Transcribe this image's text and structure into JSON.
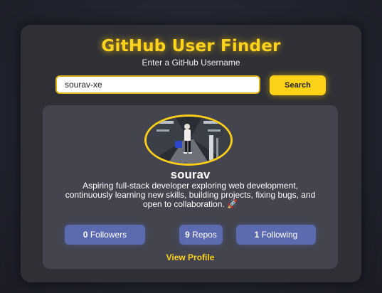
{
  "header": {
    "title": "GitHub User Finder",
    "subtitle": "Enter a GitHub Username"
  },
  "search": {
    "value": "sourav-xe",
    "placeholder": "",
    "button_label": "Search"
  },
  "profile": {
    "name": "sourav",
    "bio": "Aspiring full-stack developer exploring web development, continuously learning new skills, building projects, fixing bugs, and open to collaboration. 🚀",
    "stats": {
      "followers_count": "0",
      "followers_label": "Followers",
      "repos_count": "9",
      "repos_label": "Repos",
      "following_count": "1",
      "following_label": "Following"
    },
    "view_profile_label": "View Profile"
  },
  "colors": {
    "accent": "#ffd21a",
    "card_bg": "#2f3036",
    "profile_bg": "#43444e",
    "stat_bg": "#5c6ab0"
  }
}
